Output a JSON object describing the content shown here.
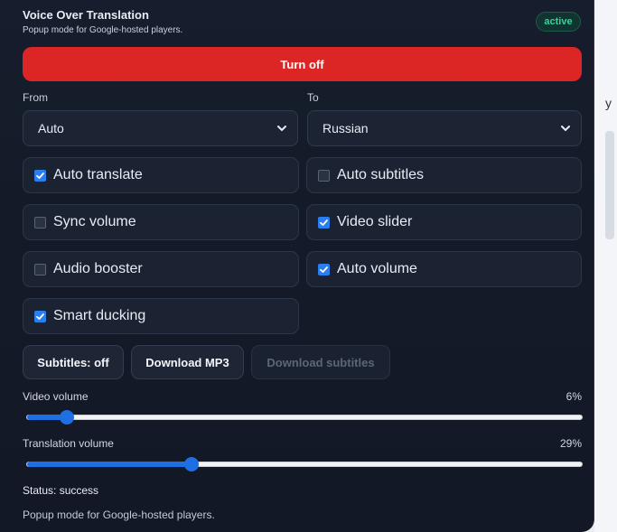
{
  "header": {
    "title": "Voice Over Translation",
    "subtitle": "Popup mode for Google-hosted players.",
    "badge": "active"
  },
  "power_button": "Turn off",
  "colors": {
    "accent": "#dc2626",
    "badge_text": "#34d399",
    "checkbox": "#2a7ff0"
  },
  "languages": {
    "from_label": "From",
    "from_value": "Auto",
    "to_label": "To",
    "to_value": "Russian"
  },
  "options": [
    {
      "label": "Auto translate",
      "checked": true
    },
    {
      "label": "Auto subtitles",
      "checked": false
    },
    {
      "label": "Sync volume",
      "checked": false
    },
    {
      "label": "Video slider",
      "checked": true
    },
    {
      "label": "Audio booster",
      "checked": false
    },
    {
      "label": "Auto volume",
      "checked": true
    },
    {
      "label": "Smart ducking",
      "checked": true
    }
  ],
  "actions": {
    "subtitles": "Subtitles: off",
    "download_mp3": "Download MP3",
    "download_subtitles": "Download subtitles"
  },
  "video_volume": {
    "label": "Video volume",
    "display": "6%",
    "value": 6
  },
  "translation_volume": {
    "label": "Translation volume",
    "display": "29%",
    "value": 29
  },
  "status": "Status: success",
  "footer": "Popup mode for Google-hosted players.",
  "side_glyph": "y"
}
